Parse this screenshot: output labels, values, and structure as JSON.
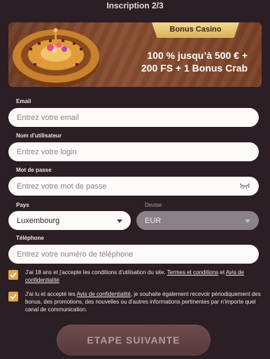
{
  "header": {
    "title": "Inscription 2/3"
  },
  "banner": {
    "ribbon": "Bonus Casino",
    "line1": "100 % jusqu’à 500 € +",
    "line2": "200 FS + 1 Bonus Crab"
  },
  "form": {
    "email": {
      "label": "Email",
      "placeholder": "Entrez votre email"
    },
    "username": {
      "label": "Nom d'utilisateur",
      "placeholder": "Entrez votre login"
    },
    "password": {
      "label": "Mot de passe",
      "placeholder": "Entrez votre mot de passe"
    },
    "country": {
      "label": "Pays",
      "value": "Luxembourg"
    },
    "currency": {
      "label": "Devise",
      "value": "EUR"
    },
    "phone": {
      "label": "Téléphone",
      "placeholder": "Entrez votre numéro de téléphone"
    }
  },
  "consents": {
    "terms": {
      "before": "J'ai 18 ans et j'accepte les conditions d'utilisation du site. ",
      "link1": "Termes et conditions",
      "middle": " et ",
      "link2": "Avis de confidentialité",
      "checked": true
    },
    "marketing": {
      "before": "J'ai lu et accepté les ",
      "link": "Avis de confidentialité",
      "after": ", je souhaite également recevoir périodiquement des bonus, des promotions, des nouvelles ou d'autres informations pertinentes par n'importe quel canal de communication.",
      "checked": true
    }
  },
  "actions": {
    "next": "ETAPE SUIVANTE"
  },
  "colors": {
    "accent": "#e7a246",
    "background": "#2b1e25",
    "ribbon": "#f3d98f"
  },
  "icons": {
    "password_toggle": "eye-closed-icon",
    "dropdown": "chevron-down-icon",
    "checkbox": "checkmark-icon"
  }
}
